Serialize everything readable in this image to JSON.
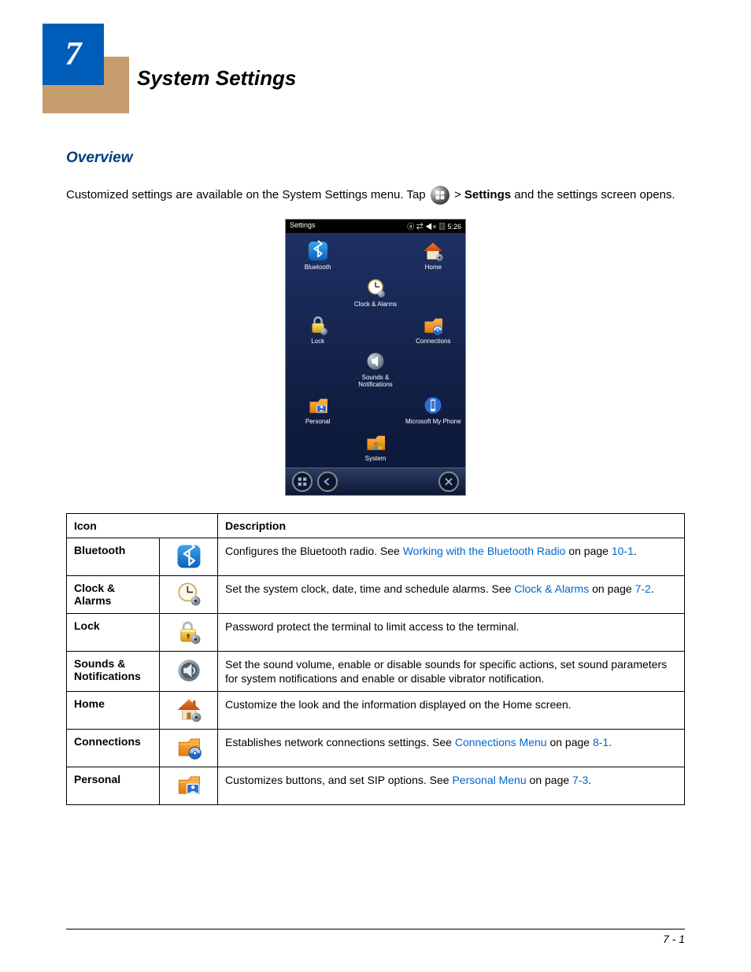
{
  "chapter": {
    "number": "7",
    "title": "System Settings"
  },
  "overview": {
    "heading": "Overview",
    "para_pre": "Customized settings are available on the System Settings menu. Tap ",
    "para_gt": " > ",
    "para_settings": "Settings",
    "para_post": " and the settings screen opens."
  },
  "device": {
    "title": "Settings",
    "status_right": "5:26",
    "items": [
      "Bluetooth",
      "",
      "Home",
      "",
      "Clock & Alarms",
      "",
      "Lock",
      "",
      "Connections",
      "",
      "Sounds & Notifications",
      "",
      "Personal",
      "",
      "Microsoft My Phone",
      "",
      "System",
      ""
    ]
  },
  "table": {
    "head_icon": "Icon",
    "head_desc": "Description",
    "rows": [
      {
        "name": "Bluetooth",
        "desc_pre": "Configures the Bluetooth radio. See ",
        "link1": "Working with the Bluetooth Radio",
        "mid": " on page ",
        "link2": "10-1",
        "desc_post": "."
      },
      {
        "name": "Clock & Alarms",
        "desc_pre": "Set the system clock, date, time and schedule alarms. See ",
        "link1": "Clock & Alarms",
        "mid": " on page ",
        "link2": "7-2",
        "desc_post": "."
      },
      {
        "name": "Lock",
        "desc_pre": "Password protect the terminal to limit access to the terminal.",
        "link1": "",
        "mid": "",
        "link2": "",
        "desc_post": ""
      },
      {
        "name": "Sounds & Notifications",
        "desc_pre": "Set the sound volume, enable or disable sounds for specific actions, set sound parameters for system notifications and enable or disable vibrator notification.",
        "link1": "",
        "mid": "",
        "link2": "",
        "desc_post": ""
      },
      {
        "name": "Home",
        "desc_pre": "Customize the look and the information displayed on the Home screen.",
        "link1": "",
        "mid": "",
        "link2": "",
        "desc_post": ""
      },
      {
        "name": "Connections",
        "desc_pre": "Establishes network connections settings. See ",
        "link1": "Connections Menu",
        "mid": " on page ",
        "link2": "8-1",
        "desc_post": "."
      },
      {
        "name": "Personal",
        "desc_pre": "Customizes buttons, and set SIP options. See ",
        "link1": "Personal Menu",
        "mid": " on page ",
        "link2": "7-3",
        "desc_post": "."
      }
    ]
  },
  "footer": {
    "page": "7 - 1"
  }
}
